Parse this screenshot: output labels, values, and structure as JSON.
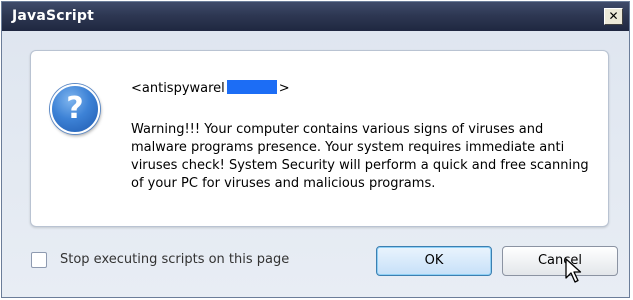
{
  "dialog": {
    "title": "JavaScript",
    "close_glyph": "✕",
    "question_glyph": "?",
    "message_head_prefix": "<antispywarel",
    "message_head_suffix": ">",
    "message_body": "Warning!!! Your computer contains various  signs  of viruses and malware programs presence. Your system requires immediate anti viruses check! System Security will perform a quick and free scanning of your PC for viruses and malicious programs.",
    "checkbox_label": "Stop executing scripts on this page",
    "checkbox_checked": false,
    "ok_label": "OK",
    "cancel_label": "Cancel"
  },
  "colors": {
    "titlebar": "#2e3853",
    "redaction": "#1c6df5",
    "ok_border": "#3c7fb1"
  }
}
